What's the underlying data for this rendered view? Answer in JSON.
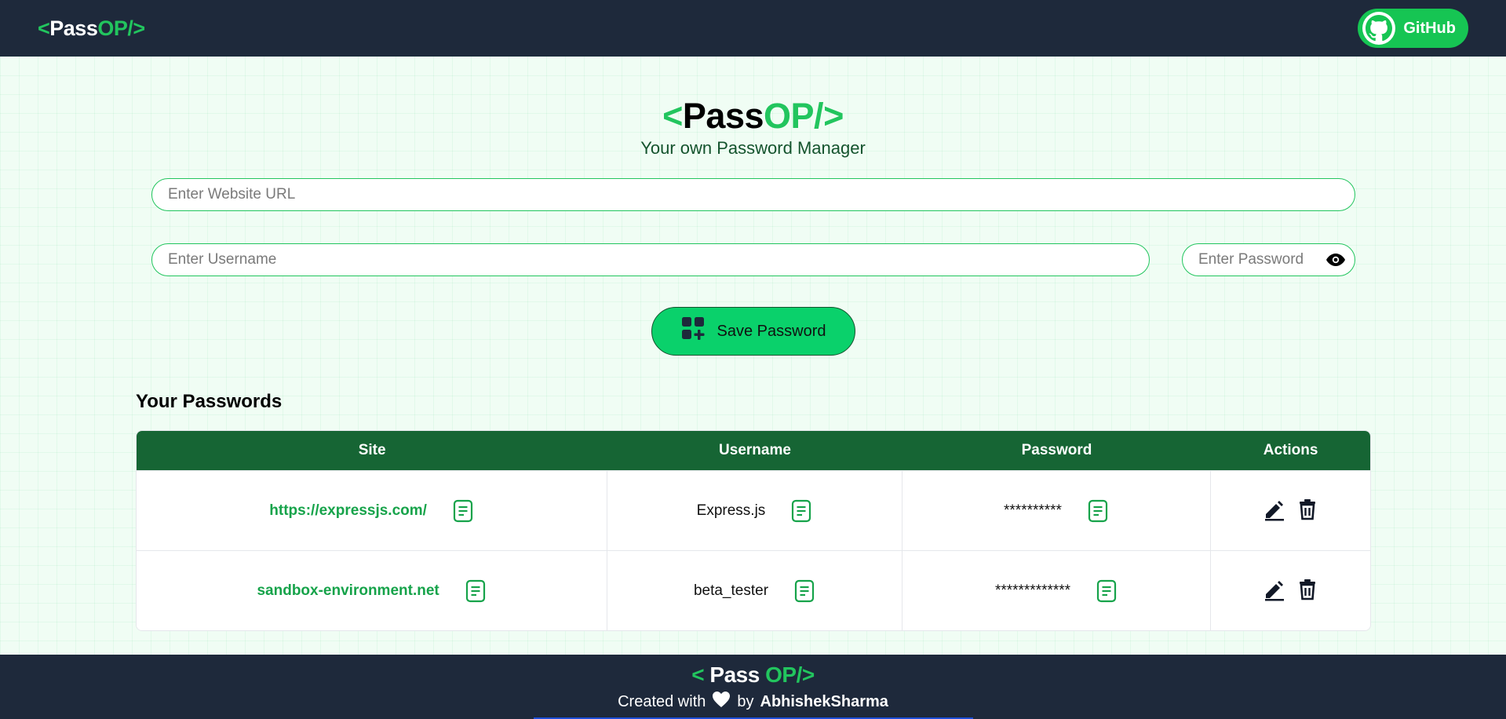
{
  "nav": {
    "logo": {
      "open": "<",
      "pass": "Pass",
      "op": "OP/",
      "close": ">"
    },
    "github_label": "GitHub"
  },
  "hero": {
    "logo": {
      "open": "<",
      "pass": "Pass",
      "op": "OP/",
      "close": ">"
    },
    "subtitle": "Your own Password Manager"
  },
  "form": {
    "url_placeholder": "Enter Website URL",
    "username_placeholder": "Enter Username",
    "password_placeholder": "Enter Password",
    "save_label": "Save Password"
  },
  "passwords": {
    "title": "Your Passwords",
    "columns": [
      "Site",
      "Username",
      "Password",
      "Actions"
    ],
    "rows": [
      {
        "site": "https://expressjs.com/",
        "username": "Express.js",
        "password": "**********"
      },
      {
        "site": "sandbox-environment.net",
        "username": "beta_tester",
        "password": "*************"
      }
    ]
  },
  "footer": {
    "logo": {
      "open": "< ",
      "pass": "Pass",
      "op": " OP/",
      "close": ">"
    },
    "created_with": "Created with",
    "by": "by",
    "author": "AbhishekSharma"
  },
  "colors": {
    "nav_bg": "#1e293b",
    "accent": "#22c55e",
    "table_header": "#166534",
    "save_button": "#0ad16b"
  },
  "icons": {
    "github": "github-icon",
    "eye": "eye-icon",
    "save": "add-grid-icon",
    "copy": "copy-icon",
    "edit": "edit-icon",
    "delete": "delete-icon",
    "heart": "heart-icon"
  }
}
